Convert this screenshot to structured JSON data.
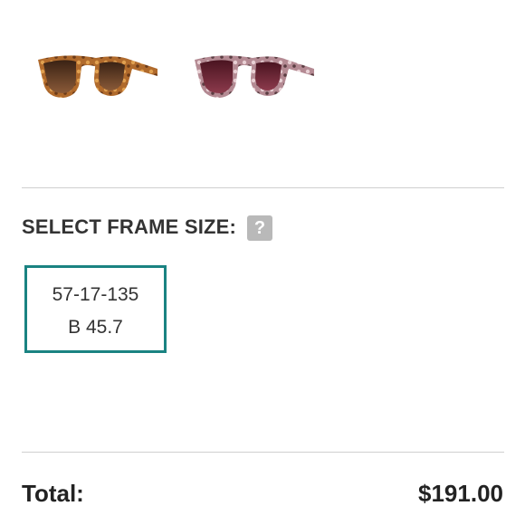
{
  "color_options": [
    {
      "name": "tortoise-brown",
      "colors": {
        "frame": "#b06a2c",
        "frame_spot": "#e0a050",
        "lens": "#5a3520"
      }
    },
    {
      "name": "pink-tortoise",
      "colors": {
        "frame": "#b48a93",
        "frame_spot": "#e8d0d4",
        "lens": "#6b2230"
      }
    }
  ],
  "frame_size": {
    "heading": "SELECT FRAME SIZE:",
    "help_glyph": "?",
    "options": [
      {
        "measurement": "57-17-135",
        "bridge": "B 45.7",
        "selected": true
      }
    ]
  },
  "total": {
    "label": "Total:",
    "value": "$191.00"
  },
  "colors": {
    "accent": "#1a8382",
    "divider": "#cfcfcf",
    "help_icon_bg": "#b9b9b9"
  }
}
